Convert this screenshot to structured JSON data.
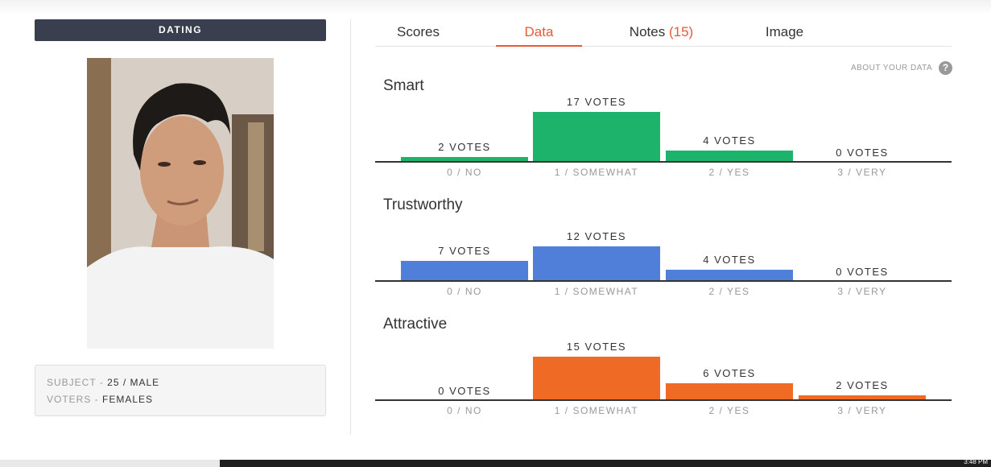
{
  "left": {
    "badge": "DATING",
    "info": [
      {
        "key": "SUBJECT",
        "value": "25 / MALE"
      },
      {
        "key": "VOTERS",
        "value": "FEMALES"
      }
    ]
  },
  "tabs": [
    {
      "label": "Scores",
      "count": ""
    },
    {
      "label": "Data",
      "count": ""
    },
    {
      "label": "Notes",
      "count": "(15)"
    },
    {
      "label": "Image",
      "count": ""
    }
  ],
  "active_tab": "Data",
  "about": {
    "label": "ABOUT YOUR DATA",
    "icon": "help-icon"
  },
  "categories": [
    "0 / NO",
    "1 / SOMEWHAT",
    "2 / YES",
    "3 / VERY"
  ],
  "chart_data": [
    {
      "type": "bar",
      "title": "Smart",
      "color": "#1db36b",
      "categories": [
        "0 / NO",
        "1 / SOMEWHAT",
        "2 / YES",
        "3 / VERY"
      ],
      "values": [
        2,
        17,
        4,
        0
      ],
      "value_labels": [
        "2 VOTES",
        "17 VOTES",
        "4 VOTES",
        "0 VOTES"
      ]
    },
    {
      "type": "bar",
      "title": "Trustworthy",
      "color": "#4f7fd9",
      "categories": [
        "0 / NO",
        "1 / SOMEWHAT",
        "2 / YES",
        "3 / VERY"
      ],
      "values": [
        7,
        12,
        4,
        0
      ],
      "value_labels": [
        "7 VOTES",
        "12 VOTES",
        "4 VOTES",
        "0 VOTES"
      ]
    },
    {
      "type": "bar",
      "title": "Attractive",
      "color": "#ef6a24",
      "categories": [
        "0 / NO",
        "1 / SOMEWHAT",
        "2 / YES",
        "3 / VERY"
      ],
      "values": [
        0,
        15,
        6,
        2
      ],
      "value_labels": [
        "0 VOTES",
        "15 VOTES",
        "6 VOTES",
        "2 VOTES"
      ]
    }
  ],
  "taskbar": {
    "time": "3:48 PM"
  }
}
